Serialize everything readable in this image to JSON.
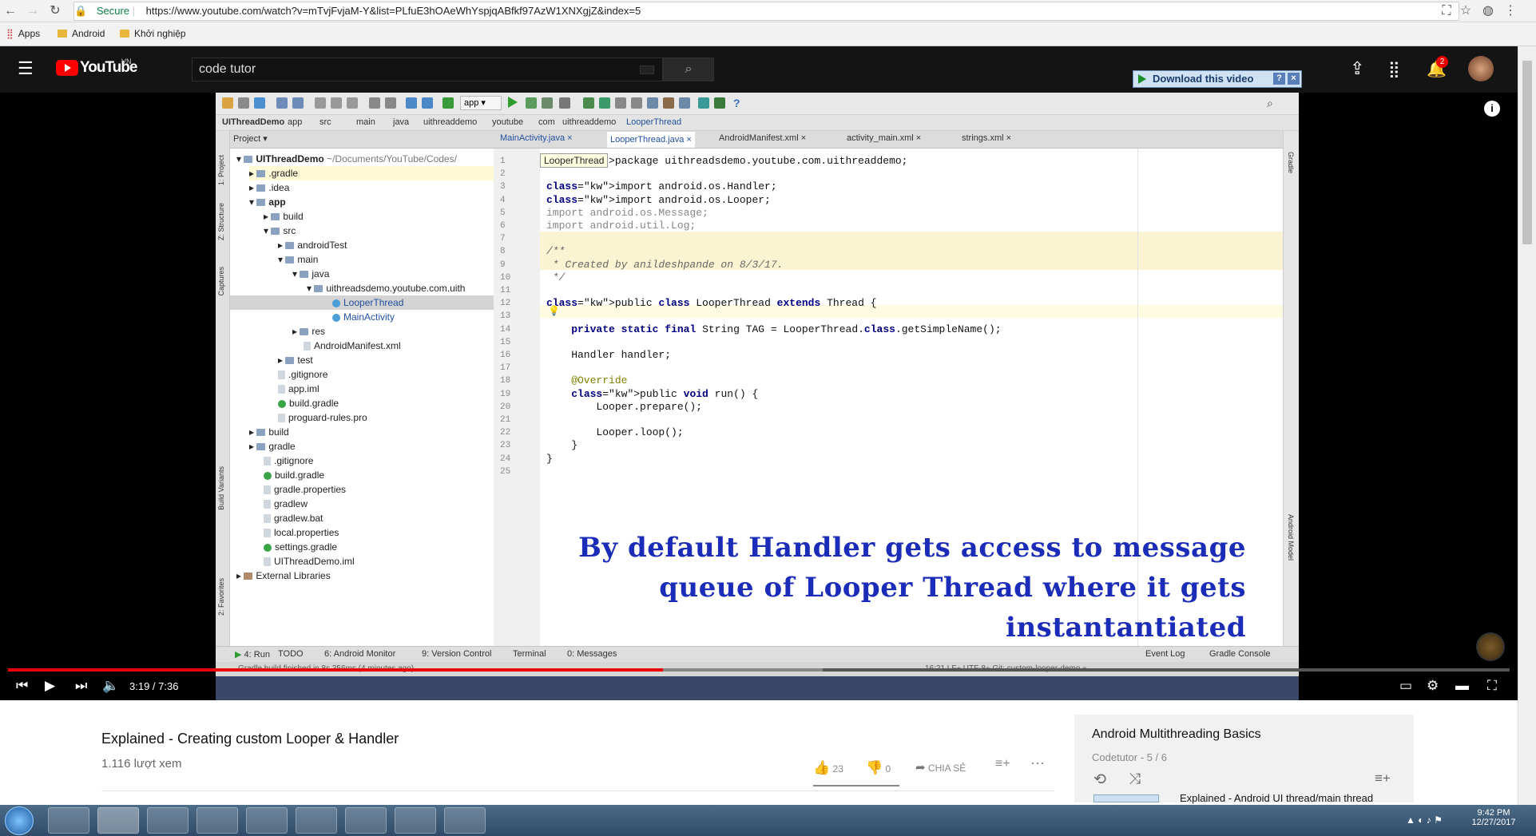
{
  "browser": {
    "secure_label": "Secure",
    "url": "https://www.youtube.com/watch?v=mTvjFvjaM-Y&list=PLfuE3hOAeWhYspjqABfkf97AzW1XNXgjZ&index=5",
    "bookmarks": [
      "Apps",
      "Android",
      "Khởi nghiệp"
    ]
  },
  "youtube": {
    "logo": "YouTube",
    "region": "VN",
    "search_value": "code tutor",
    "download_button": "Download this video",
    "notification_count": "2"
  },
  "ide": {
    "breadcrumbs": [
      "UIThreadDemo",
      "app",
      "src",
      "main",
      "java",
      "uithreaddemo",
      "youtube",
      "com",
      "uithreaddemo",
      "LooperThread"
    ],
    "project_label": "Project",
    "tabs": [
      "MainActivity.java",
      "LooperThread.java",
      "AndroidManifest.xml",
      "activity_main.xml",
      "strings.xml"
    ],
    "active_tab": "LooperThread.java",
    "tooltip": "LooperThread",
    "tree": [
      {
        "label": "UIThreadDemo",
        "extra": "~/Documents/YouTube/Codes/",
        "type": "folder"
      },
      {
        "label": ".gradle",
        "type": "folder"
      },
      {
        "label": ".idea",
        "type": "folder"
      },
      {
        "label": "app",
        "type": "folder"
      },
      {
        "label": "build",
        "type": "folder"
      },
      {
        "label": "src",
        "type": "folder"
      },
      {
        "label": "androidTest",
        "type": "folder"
      },
      {
        "label": "main",
        "type": "folder"
      },
      {
        "label": "java",
        "type": "folder"
      },
      {
        "label": "uithreadsdemo.youtube.com.uith",
        "type": "folder"
      },
      {
        "label": "LooperThread",
        "type": "class"
      },
      {
        "label": "MainActivity",
        "type": "class"
      },
      {
        "label": "res",
        "type": "folder"
      },
      {
        "label": "AndroidManifest.xml",
        "type": "file"
      },
      {
        "label": "test",
        "type": "folder"
      },
      {
        "label": ".gitignore",
        "type": "file"
      },
      {
        "label": "app.iml",
        "type": "file"
      },
      {
        "label": "build.gradle",
        "type": "gradle"
      },
      {
        "label": "proguard-rules.pro",
        "type": "file"
      },
      {
        "label": "build",
        "type": "folder"
      },
      {
        "label": "gradle",
        "type": "folder"
      },
      {
        "label": ".gitignore",
        "type": "file"
      },
      {
        "label": "build.gradle",
        "type": "gradle"
      },
      {
        "label": "gradle.properties",
        "type": "file"
      },
      {
        "label": "gradlew",
        "type": "file"
      },
      {
        "label": "gradlew.bat",
        "type": "file"
      },
      {
        "label": "local.properties",
        "type": "file"
      },
      {
        "label": "settings.gradle",
        "type": "gradle"
      },
      {
        "label": "UIThreadDemo.iml",
        "type": "file"
      },
      {
        "label": "External Libraries",
        "type": "folder"
      }
    ],
    "code_lines": [
      "package uithreadsdemo.youtube.com.uithreaddemo;",
      "",
      "import android.os.Handler;",
      "import android.os.Looper;",
      "import android.os.Message;",
      "import android.util.Log;",
      "",
      "/**",
      " * Created by anildeshpande on 8/3/17.",
      " */",
      "",
      "public class LooperThread extends Thread {",
      "",
      "    private static final String TAG = LooperThread.class.getSimpleName();",
      "",
      "    Handler handler;",
      "",
      "    @Override",
      "    public void run() {",
      "        Looper.prepare();",
      "",
      "        Looper.loop();",
      "    }",
      "}",
      ""
    ],
    "overlay_lines": [
      "By default Handler gets access to message",
      "queue of Looper Thread where it gets",
      "instantantiated"
    ],
    "bottom_tools": [
      "4: Run",
      "TODO",
      "6: Android Monitor",
      "9: Version Control",
      "Terminal",
      "0: Messages",
      "Event Log",
      "Gradle Console"
    ],
    "status_left": "Gradle build finished in 8s 356ms (4 minutes ago)",
    "status_right": "16:21  LF÷  UTF-8÷  Git: custom-looper-demo ÷",
    "side_left": [
      "1: Project",
      "Z: Structure",
      "Captures",
      "Build Variants",
      "2: Favorites"
    ],
    "side_right": [
      "Gradle",
      "Android Model"
    ]
  },
  "player": {
    "time": "3:19 / 7:36",
    "progress_fraction": 0.436
  },
  "video": {
    "title": "Explained - Creating custom Looper & Handler",
    "views": "1.116 lượt xem",
    "likes": "23",
    "dislikes": "0",
    "share_label": "CHIA SẺ"
  },
  "playlist": {
    "title": "Android Multithreading Basics",
    "meta": "Codetutor - 5 / 6",
    "next": "Explained - Android UI thread/main thread"
  },
  "taskbar": {
    "time": "9:42 PM",
    "date": "12/27/2017"
  }
}
